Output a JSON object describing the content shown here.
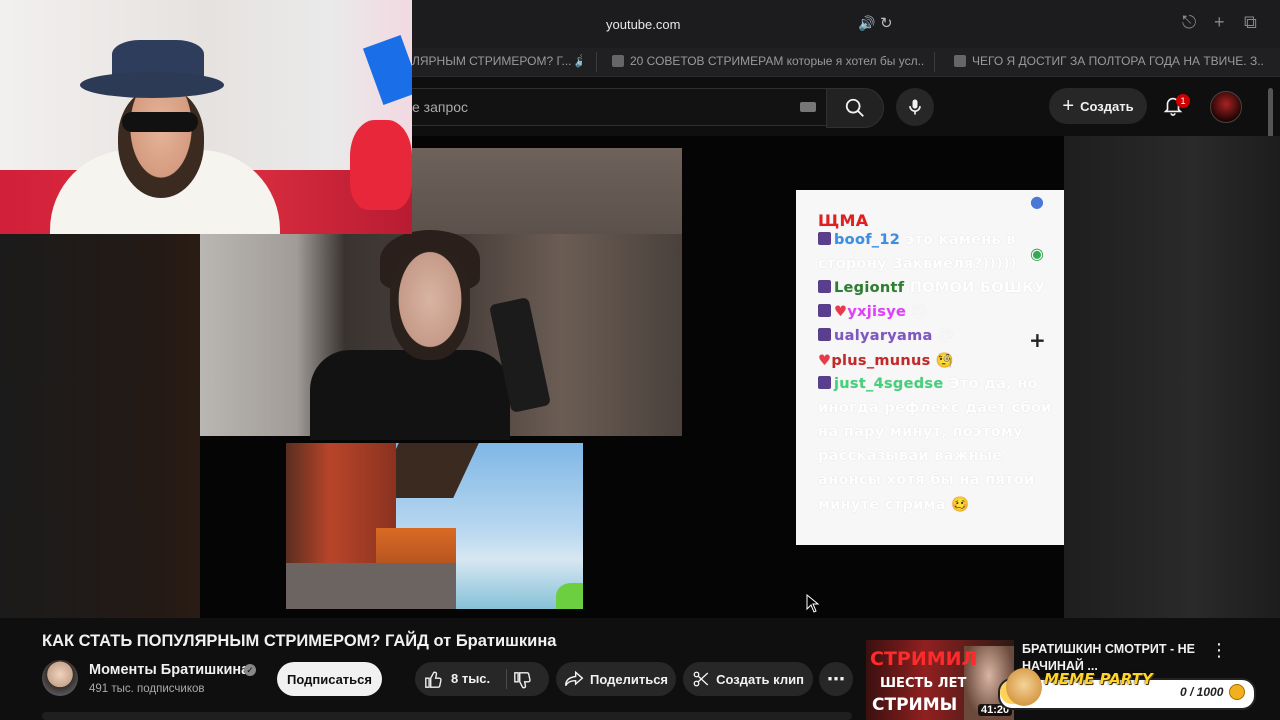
{
  "browser": {
    "url": "youtube.com",
    "tabs": [
      "ЛЯРНЫМ СТРИМЕРОМ? Г...",
      "20 СОВЕТОВ СТРИМЕРАМ которые я хотел бы усл...",
      "ЧЕГО Я ДОСТИГ ЗА ПОЛТОРА ГОДА НА ТВИЧЕ. З..."
    ]
  },
  "header": {
    "search_placeholder": "е запрос",
    "create_label": "Создать",
    "notifications_count": "1"
  },
  "chat": {
    "title": "ЩМА",
    "messages": [
      {
        "user": "boof_12",
        "user_color": "#3a8ee6",
        "text": " это камень в",
        "badge": true,
        "heart": false
      },
      {
        "user": "",
        "user_color": "#ffffff",
        "text": "сторону Заквиеля?)))))",
        "badge": false,
        "heart": false
      },
      {
        "user": "Legiontf",
        "user_color": "#2e7d32",
        "text": " ПОМОЙ БОШКУ",
        "badge": true,
        "heart": false
      },
      {
        "user": "yxjisye",
        "user_color": "#e040fb",
        "text": " 😔",
        "badge": true,
        "heart": true
      },
      {
        "user": "ualyaryama",
        "user_color": "#7e57c2",
        "text": " 😔",
        "badge": true,
        "heart": false
      },
      {
        "user": "plus_munus",
        "user_color": "#c62828",
        "text": " 🧐",
        "badge": false,
        "heart": true
      },
      {
        "user": "just_4sgedse",
        "user_color": "#43d17a",
        "text": " Это да, но",
        "badge": true,
        "heart": false
      },
      {
        "user": "",
        "user_color": "#ffffff",
        "text": "иногда рефлекс дает сбой",
        "badge": false,
        "heart": false
      },
      {
        "user": "",
        "user_color": "#ffffff",
        "text": "на пару минут, поэтому",
        "badge": false,
        "heart": false
      },
      {
        "user": "",
        "user_color": "#ffffff",
        "text": "рассказывай важные",
        "badge": false,
        "heart": false
      },
      {
        "user": "",
        "user_color": "#ffffff",
        "text": "анонсы хотя бы на пятой",
        "badge": false,
        "heart": false
      },
      {
        "user": "",
        "user_color": "#ffffff",
        "text": "минуте стрима 🥴",
        "badge": false,
        "heart": false
      }
    ]
  },
  "video": {
    "title": "КАК СТАТЬ ПОПУЛЯРНЫМ СТРИМЕРОМ? ГАЙД от Братишкина",
    "channel_name": "Моменты Братишкина",
    "subscribers": "491 тыс. подписчиков",
    "subscribe_label": "Подписаться",
    "likes": "8 тыс.",
    "share_label": "Поделиться",
    "clip_label": "Создать клип"
  },
  "recommendation": {
    "thumb_line1": "СТРИМИЛ",
    "thumb_line2": "ШЕСТЬ ЛЕТ",
    "thumb_line3": "СТРИМЫ",
    "duration": "41:20",
    "title": "БРАТИШКИН СМОТРИТ - НЕ НАЧИНАЙ ..."
  },
  "overlay": {
    "meme_label": "MEME PARTY",
    "meme_count": "0 / 1000"
  },
  "colors": {
    "accent_red": "#cc0000",
    "chat_title": "#e02020"
  }
}
